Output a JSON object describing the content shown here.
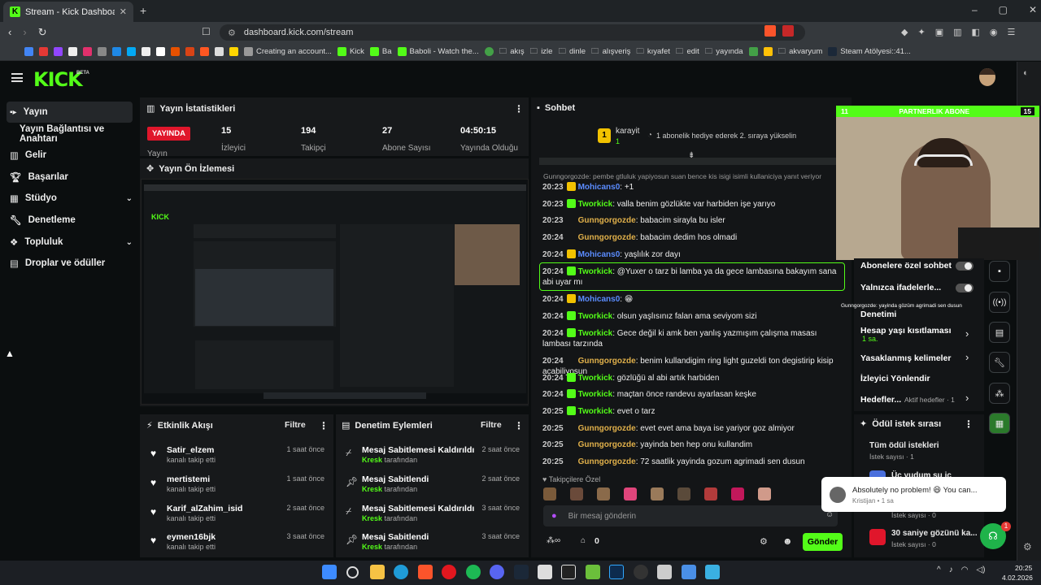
{
  "browser": {
    "tab_title": "Stream - Kick Dashboard",
    "url": "dashboard.kick.com/stream",
    "bookmarks": [
      "Creating an account...",
      "Kick",
      "Ba",
      "Baboli - Watch the...",
      "akış",
      "izle",
      "dinle",
      "alışveriş",
      "kıyafet",
      "edit",
      "yayında",
      "akvaryum",
      "Steam Atölyesi::41..."
    ]
  },
  "sidebar": {
    "items": [
      {
        "label": "Yayın"
      },
      {
        "label": "Yayın Bağlantısı ve Anahtarı"
      },
      {
        "label": "Gelir"
      },
      {
        "label": "Başarılar"
      },
      {
        "label": "Stüdyo"
      },
      {
        "label": "Denetleme"
      },
      {
        "label": "Topluluk"
      },
      {
        "label": "Droplar ve ödüller"
      }
    ]
  },
  "stats": {
    "title": "Yayın İstatistikleri",
    "live_badge": "YAYINDA",
    "live_label": "Yayın",
    "items": [
      {
        "value": "15",
        "label": "İzleyici"
      },
      {
        "value": "194",
        "label": "Takipçi"
      },
      {
        "value": "27",
        "label": "Abone Sayısı"
      },
      {
        "value": "04:50:15",
        "label": "Yayında Olduğu"
      }
    ]
  },
  "preview": {
    "title": "Yayın Ön İzlemesi"
  },
  "activity": {
    "title": "Etkinlik Akışı",
    "filter": "Filtre",
    "items": [
      {
        "name": "Satir_elzem",
        "sub": "kanalı takip etti",
        "time": "1 saat önce"
      },
      {
        "name": "mertistemi",
        "sub": "kanalı takip etti",
        "time": "1 saat önce"
      },
      {
        "name": "Karif_alZahim_isid",
        "sub": "kanalı takip etti",
        "time": "2 saat önce"
      },
      {
        "name": "eymen16bjk",
        "sub": "kanalı takip etti",
        "time": "3 saat önce"
      }
    ]
  },
  "moderation": {
    "title": "Denetim Eylemleri",
    "filter": "Filtre",
    "by_word": "tarafından",
    "items": [
      {
        "action": "Mesaj Sabitlemesi Kaldırıldı",
        "by": "Kresk",
        "time": "2 saat önce"
      },
      {
        "action": "Mesaj Sabitlendi",
        "by": "Kresk",
        "time": "2 saat önce"
      },
      {
        "action": "Mesaj Sabitlemesi Kaldırıldı",
        "by": "Kresk",
        "time": "3 saat önce"
      },
      {
        "action": "Mesaj Sabitlendi",
        "by": "Kresk",
        "time": "3 saat önce"
      }
    ]
  },
  "chat": {
    "title": "Sohbet",
    "top_gifter": "karayit",
    "gifter_count": "1",
    "gift_prompt": "1 abonelik hediye ederek 2. sıraya yükselin",
    "reply_hint": "Gunngorgozde: pembe gtluluk yapiyosun suan bence kis isigi isimli kullaniciya yanıt veriyor",
    "messages": [
      {
        "time": "20:23",
        "user": "Mohicans0",
        "color": "#5b8cff",
        "text": "+1"
      },
      {
        "time": "20:23",
        "user": "Tworkick",
        "color": "#53fc18",
        "text": "valla benim gözlükte var harbiden işe yarıyo"
      },
      {
        "time": "20:23",
        "user": "Gunngorgozde",
        "color": "#e0b04a",
        "text": "babacim sirayla bu isler"
      },
      {
        "time": "20:24",
        "user": "Gunngorgozde",
        "color": "#e0b04a",
        "text": "babacim dedim hos olmadi"
      },
      {
        "time": "20:24",
        "user": "Mohicans0",
        "color": "#5b8cff",
        "text": "yaşlılık zor dayı"
      },
      {
        "time": "20:24",
        "user": "Tworkick",
        "color": "#53fc18",
        "text": "@Yuxer o tarz bi lamba ya da gece lambasına bakayım sana abi uyar mı"
      },
      {
        "time": "20:24",
        "user": "Mohicans0",
        "color": "#5b8cff",
        "text": "😁"
      },
      {
        "time": "20:24",
        "user": "Tworkick",
        "color": "#53fc18",
        "text": "olsun yaşlısınız falan ama seviyom sizi"
      },
      {
        "time": "20:24",
        "user": "Tworkick",
        "color": "#53fc18",
        "text": "Gece değil ki amk ben yanlış yazmışım çalışma masası lambası tarzında"
      },
      {
        "time": "20:24",
        "user": "Gunngorgozde",
        "color": "#e0b04a",
        "text": "benim kullandigim ring light guzeldi ton degistirip kisip acabiliyosun"
      },
      {
        "time": "20:24",
        "user": "Tworkick",
        "color": "#53fc18",
        "text": "gözlüğü al abi artık harbiden"
      },
      {
        "time": "20:24",
        "user": "Tworkick",
        "color": "#53fc18",
        "text": "maçtan önce randevu ayarlasan keşke"
      },
      {
        "time": "20:25",
        "user": "Tworkick",
        "color": "#53fc18",
        "text": "evet o tarz"
      },
      {
        "time": "20:25",
        "user": "Gunngorgozde",
        "color": "#e0b04a",
        "text": "evet evet ama baya ise yariyor goz almiyor"
      },
      {
        "time": "20:25",
        "user": "Gunngorgozde",
        "color": "#e0b04a",
        "text": "yayinda ben hep onu kullandim"
      },
      {
        "time": "20:25",
        "user": "Gunngorgozde",
        "color": "#e0b04a",
        "text": "72 saatlik yayinda gozum agrimadi sen dusun"
      }
    ],
    "followers_only": "Takipçilere Özel",
    "placeholder": "Bir mesaj gönderin",
    "points": "0",
    "send": "Gönder"
  },
  "webcam_overlay": {
    "left": "11",
    "label": "PARTNERLIK ABONE",
    "right": "15"
  },
  "right_panel": {
    "sub_only": "Abonelere özel sohbet",
    "emote_only": "Yalnızca ifadelerle...",
    "moderation": "Denetimi",
    "age_limit": "Hesap yaşı kısıtlaması",
    "age_value": "1 sa.",
    "banned_words": "Yasaklanmış kelimeler",
    "viewer_redirect": "İzleyici Yönlendir",
    "goals": "Hedefler...",
    "goals_sub": "Aktif hedefler · 1",
    "reward_queue": "Ödül istek sırası",
    "all_requests": "Tüm ödül istekleri",
    "request_count1": "İstek sayısı · 1",
    "reward_item": "Üç yudum su iç",
    "reward_item2": "30 saniye gözünü ka...",
    "request_count0": "İstek sayısı · 0",
    "overlay_text": "Gunngorgozde: yayinda gözüm agrimadi sen dusun"
  },
  "toast": {
    "text": "Absolutely no problem! 😆  You can...",
    "sub": "Kristijan • 1 sa",
    "badge": "1"
  },
  "taskbar": {
    "time": "20:25",
    "date": "4.02.2026"
  }
}
